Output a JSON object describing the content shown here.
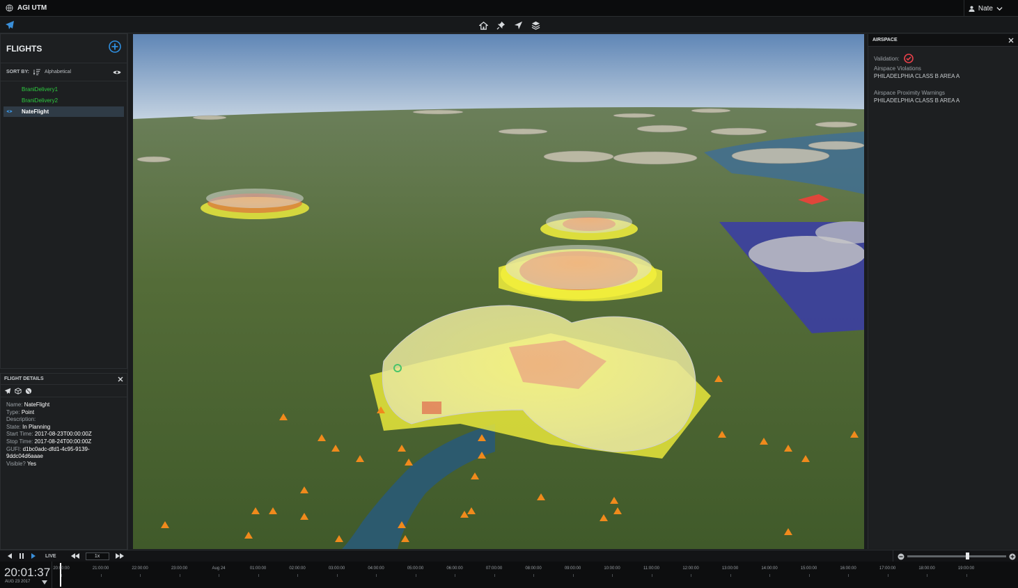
{
  "app": {
    "title": "AGI UTM",
    "user": "Nate"
  },
  "flights_panel": {
    "title": "FLIGHTS",
    "sort_label": "SORT BY:",
    "sort_value": "Alphabetical",
    "items": [
      {
        "name": "BraniDelivery1",
        "color": "#2ecc40",
        "selected": false
      },
      {
        "name": "BraniDelivery2",
        "color": "#2ecc40",
        "selected": false
      },
      {
        "name": "NateFlight",
        "color": "#ffffff",
        "selected": true
      }
    ]
  },
  "flight_details": {
    "title": "FLIGHT DETAILS",
    "fields": [
      {
        "key": "Name:",
        "value": "NateFlight"
      },
      {
        "key": "Type:",
        "value": "Point"
      },
      {
        "key": "Description:",
        "value": ""
      },
      {
        "key": "State:",
        "value": "In Planning"
      },
      {
        "key": "Start Time:",
        "value": "2017-08-23T00:00:00Z"
      },
      {
        "key": "Stop Time:",
        "value": "2017-08-24T00:00:00Z"
      },
      {
        "key": "GUFI:",
        "value": "d1bc0adc-dfd1-4c95-9139-9ddc04d6aaae"
      },
      {
        "key": "Visible?",
        "value": "Yes"
      }
    ]
  },
  "airspace": {
    "title": "AIRSPACE",
    "validation_label": "Validation:",
    "violations_label": "Airspace Violations",
    "violations_value": "PHILADELPHIA CLASS B AREA A",
    "warnings_label": "Airspace Proximity Warnings",
    "warnings_value": "PHILADELPHIA CLASS B AREA A",
    "status_color": "#e8414a"
  },
  "playback": {
    "live_label": "LIVE",
    "speed": "1x"
  },
  "timeline": {
    "current_time": "20:01:37",
    "current_date": "AUG 23 2017",
    "labels": [
      "20:00:00",
      "21:00:00",
      "22:00:00",
      "23:00:00",
      "Aug 24",
      "01:00:00",
      "02:00:00",
      "03:00:00",
      "04:00:00",
      "05:00:00",
      "06:00:00",
      "07:00:00",
      "08:00:00",
      "09:00:00",
      "10:00:00",
      "11:00:00",
      "12:00:00",
      "13:00:00",
      "14:00:00",
      "15:00:00",
      "16:00:00",
      "17:00:00",
      "18:00:00",
      "19:00:00"
    ]
  },
  "map": {
    "colors": {
      "terrain": "#4e6b34",
      "sky": "#7f9bbf",
      "river": "#2c5a6e",
      "restricted_yellow": "#f3f03c",
      "restricted_red": "#e0463a",
      "class_b_blue": "#3a3ca8",
      "marker_orange": "#f08a1c"
    }
  },
  "icons": [
    "globe-icon",
    "user-icon",
    "chevron-down-icon",
    "plane-icon",
    "home-icon",
    "pin-icon",
    "navigate-icon",
    "layers-icon",
    "add-circle-icon",
    "sort-icon",
    "eye-icon",
    "close-icon",
    "cube-icon",
    "check-circle-icon",
    "play-icon",
    "pause-icon",
    "step-back-icon",
    "rewind-icon",
    "fast-forward-icon",
    "zoom-out-icon",
    "zoom-in-icon"
  ]
}
